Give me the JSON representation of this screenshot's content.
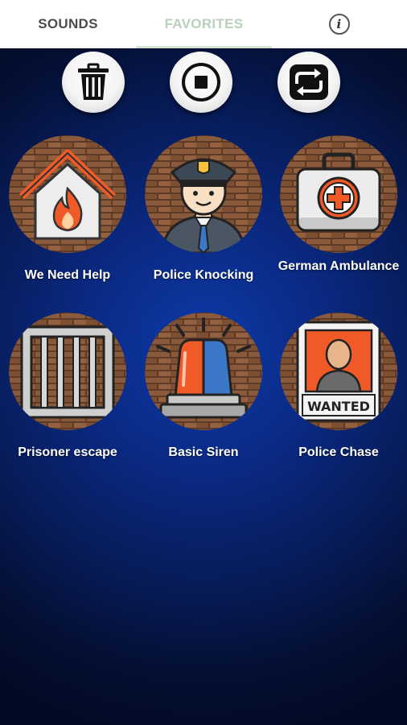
{
  "tabs": {
    "sounds": "SOUNDS",
    "favorites": "FAVORITES",
    "info_icon": "i"
  },
  "controls": [
    {
      "name": "trash-icon"
    },
    {
      "name": "stop-icon"
    },
    {
      "name": "repeat-icon"
    }
  ],
  "sounds": [
    {
      "label": "We Need Help",
      "icon": "house-fire-icon"
    },
    {
      "label": "Police Knocking",
      "icon": "police-officer-icon"
    },
    {
      "label": "German Ambulance",
      "icon": "first-aid-kit-icon"
    },
    {
      "label": "Prisoner escape",
      "icon": "jail-bars-icon"
    },
    {
      "label": "Basic Siren",
      "icon": "siren-light-icon"
    },
    {
      "label": "Police Chase",
      "icon": "wanted-poster-icon"
    }
  ],
  "wanted_text": "WANTED",
  "colors": {
    "tab_active": "#b9d0bb",
    "tab_inactive": "#4b4b4b",
    "background_center": "#0d3aa8",
    "background_edge": "#020a24",
    "brick": "#8a5a3c",
    "accent_orange": "#f05a28",
    "label_text": "#ffffff"
  }
}
